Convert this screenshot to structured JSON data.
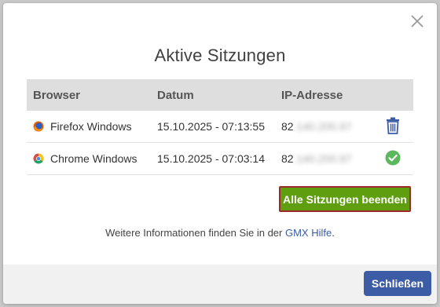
{
  "dialog": {
    "title": "Aktive Sitzungen",
    "close_icon": "close-icon"
  },
  "table": {
    "headers": [
      "Browser",
      "Datum",
      "IP-Adresse"
    ],
    "rows": [
      {
        "browser": "Firefox Windows",
        "browser_icon": "firefox-icon",
        "date": "15.10.2025 - 07:13:55",
        "ip_visible": "82",
        "ip_hidden": ".140.200.97",
        "action_icon": "trash-icon"
      },
      {
        "browser": "Chrome Windows",
        "browser_icon": "chrome-icon",
        "date": "15.10.2025 - 07:03:14",
        "ip_visible": "82",
        "ip_hidden": ".140.200.97",
        "action_icon": "check-circle-icon"
      }
    ]
  },
  "end_all_button": "Alle Sitzungen beenden",
  "info": {
    "prefix": "Weitere Informationen finden Sie in der ",
    "link": "GMX Hilfe",
    "suffix": "."
  },
  "footer": {
    "close_button": "Schließen"
  },
  "colors": {
    "primary_blue": "#3d5ca6",
    "green": "#5f9e0e",
    "check_green": "#5cb85c",
    "trash_blue": "#3d5ca6"
  }
}
